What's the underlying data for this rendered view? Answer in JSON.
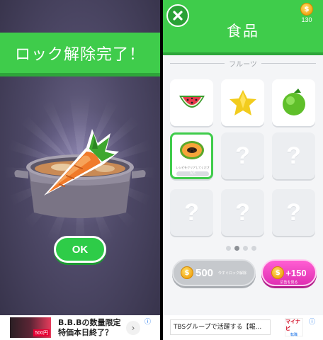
{
  "left_panel": {
    "banner_title": "ロック解除完了！",
    "ok_label": "OK",
    "unlocked_item_icon": "carrot-icon"
  },
  "right_panel": {
    "close_icon": "close-icon",
    "title": "食品",
    "coins": {
      "icon": "coin-icon",
      "symbol": "$",
      "count": "130"
    },
    "section_label": "フルーツ",
    "items": [
      {
        "name": "watermelon",
        "icon": "watermelon-icon",
        "locked": false
      },
      {
        "name": "starfruit",
        "icon": "starfruit-icon",
        "locked": false
      },
      {
        "name": "lime",
        "icon": "lime-icon",
        "locked": false
      },
      {
        "name": "papaya",
        "icon": "papaya-icon",
        "locked": false,
        "selected": true,
        "caption": "レシピをクリアしてください",
        "progress": "0/5",
        "progress_fraction": 0.0
      },
      {
        "name": "locked",
        "symbol": "?",
        "locked": true
      },
      {
        "name": "locked",
        "symbol": "?",
        "locked": true
      },
      {
        "name": "locked",
        "symbol": "?",
        "locked": true
      },
      {
        "name": "locked",
        "symbol": "?",
        "locked": true
      },
      {
        "name": "locked",
        "symbol": "?",
        "locked": true
      }
    ],
    "page_dots": {
      "count": 4,
      "active_index": 1
    },
    "unlock_button": {
      "price": "500",
      "sub_label": "今すぐロック解除"
    },
    "ad_button": {
      "amount": "+150",
      "sub_label": "広告を見る"
    }
  },
  "ads": {
    "left": {
      "line1": "B.B.Bの数量限定",
      "line2": "特価本日終了？",
      "thumb_price": "500円",
      "chevron": "›",
      "info": "ⓘ"
    },
    "right": {
      "text": "TBSグループで活躍する【報...",
      "logo_top": "マイナビ",
      "logo_bottom": "転職",
      "info": "ⓘ"
    }
  },
  "colors": {
    "accent_green": "#3fcc4b",
    "unlock_gray": "#c6c9cd",
    "ad_pink": "#ef3fc0",
    "coin_gold": "#f2a81a"
  }
}
